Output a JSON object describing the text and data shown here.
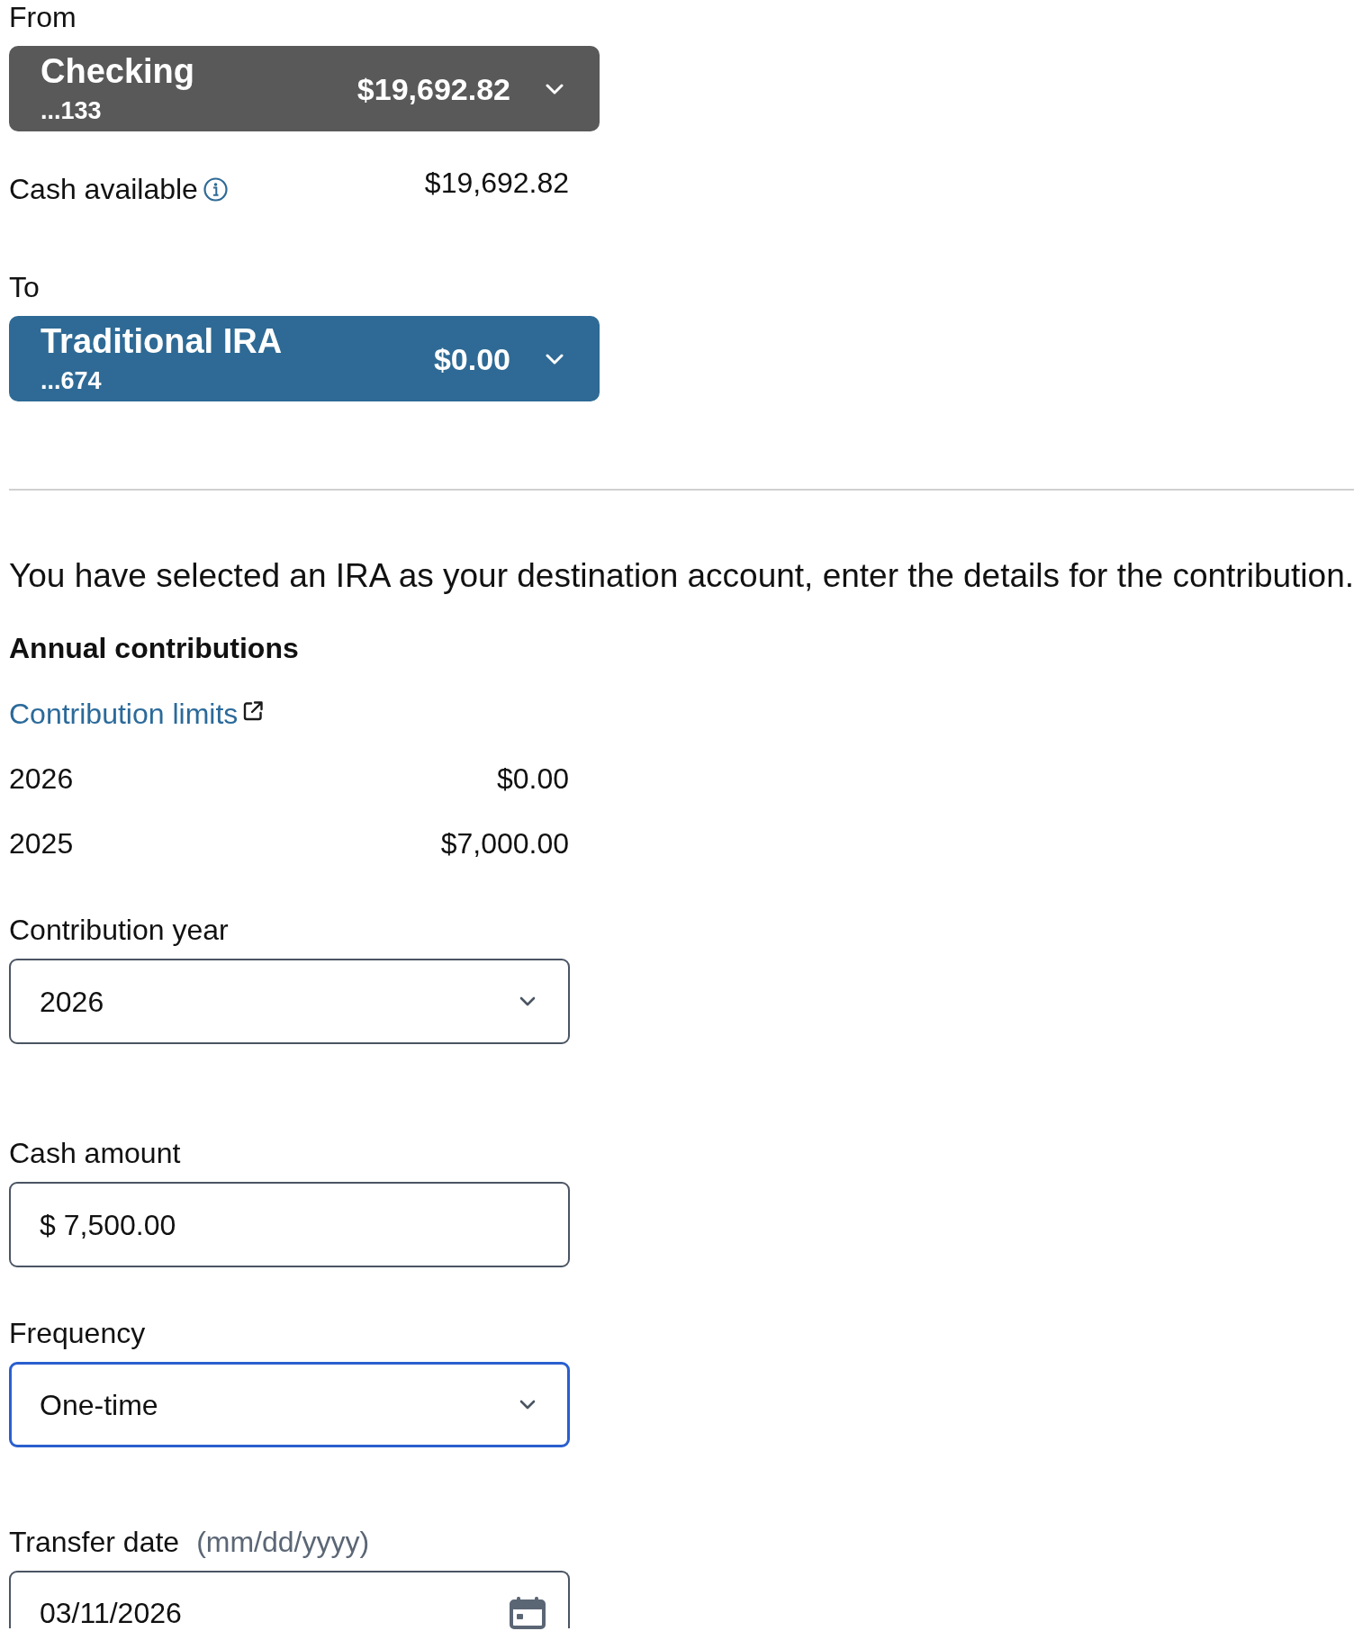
{
  "account_selectors": [
    {
      "label": "From",
      "name": "Checking",
      "number": "...133",
      "balance": "$19,692.82",
      "color": "#595959",
      "detail": {
        "label": "Cash available",
        "value": "$19,692.82"
      }
    },
    {
      "label": "To",
      "name": "Traditional IRA",
      "number": "...674",
      "balance": "$0.00",
      "color": "#2e6a95"
    }
  ],
  "message": "You have selected an IRA as your destination account, enter the details for the contribution.",
  "annual_contributions": {
    "title": "Annual contributions",
    "link": "Contribution limits",
    "rows": [
      {
        "year": "2026",
        "amount": "$0.00"
      },
      {
        "year": "2025",
        "amount": "$7,000.00"
      }
    ]
  },
  "fields": [
    {
      "kind": "select",
      "label": "Contribution year",
      "value": "2026",
      "focused": false
    },
    {
      "kind": "input",
      "label": "Cash amount",
      "value": "$ 7,500.00",
      "focused": false
    },
    {
      "kind": "select",
      "label": "Frequency",
      "value": "One-time",
      "focused": true
    },
    {
      "kind": "date",
      "label": "Transfer date",
      "format_hint": "(mm/dd/yyyy)",
      "value": "03/11/2026",
      "focused": false
    }
  ]
}
